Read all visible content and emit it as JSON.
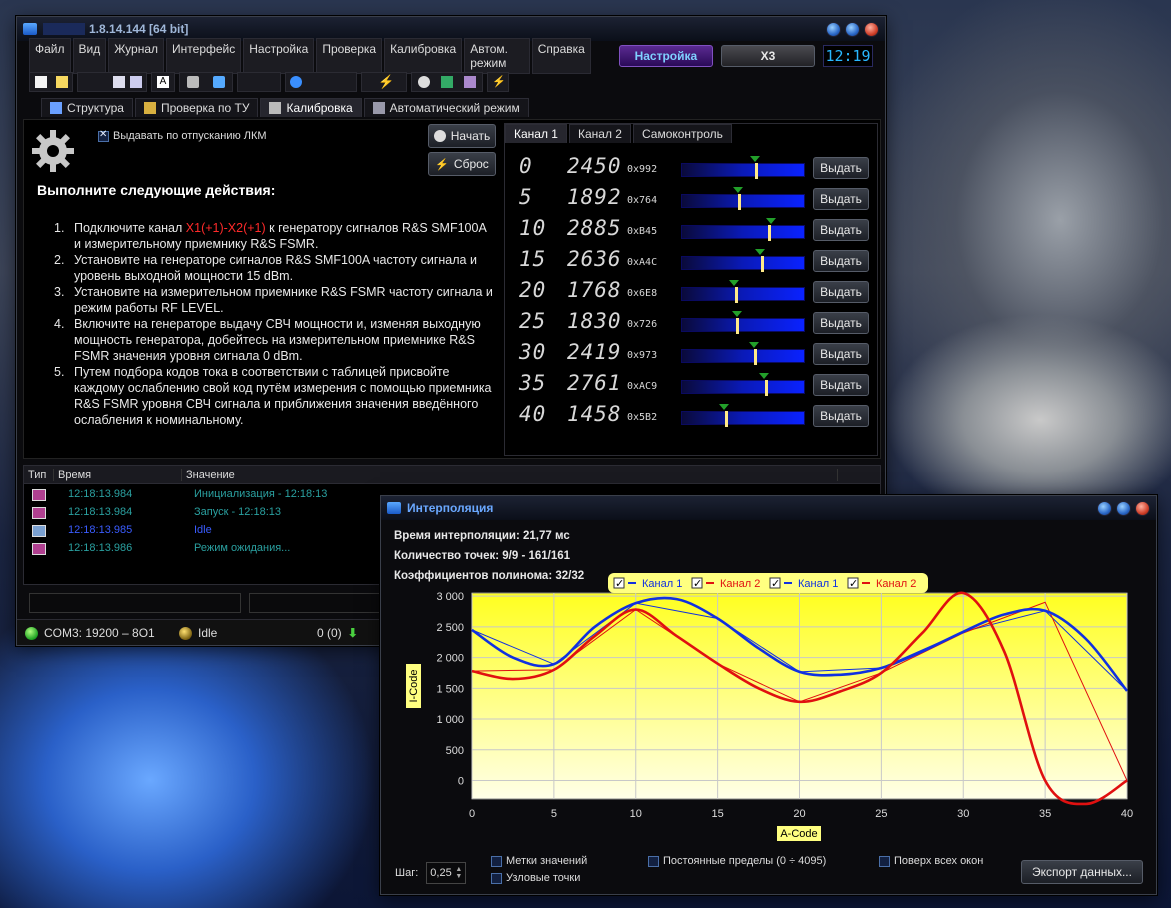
{
  "main_window": {
    "title": "1.8.14.144 [64 bit]",
    "menu": [
      "Файл",
      "Вид",
      "Журнал",
      "Интерфейс",
      "Настройка",
      "Проверка",
      "Калибровка",
      "Автом. режим",
      "Справка"
    ],
    "mode_button": "Настройка",
    "x3_button": "X3",
    "clock": "12:19",
    "tabs": [
      "Структура",
      "Проверка по ТУ",
      "Калибровка",
      "Автоматический режим"
    ],
    "active_tab": 2
  },
  "calibration": {
    "checkbox_label": "Выдавать по отпусканию ЛКМ",
    "start_button": "Начать",
    "reset_button": "Сброс",
    "heading": "Выполните следующие действия:",
    "steps": [
      {
        "n": "1.",
        "pre": "Подключите канал ",
        "red": "X1(+1)-X2(+1)",
        "post": " к генератору сигналов R&S SMF100A и измерительному приемнику R&S FSMR."
      },
      {
        "n": "2.",
        "pre": "Установите на генераторе сигналов R&S SMF100A частоту сигнала и уровень выходной мощности 15 dBm.",
        "red": "",
        "post": ""
      },
      {
        "n": "3.",
        "pre": "Установите на измерительном приемнике R&S FSMR частоту сигнала и режим работы RF LEVEL.",
        "red": "",
        "post": ""
      },
      {
        "n": "4.",
        "pre": "Включите на генераторе выдачу СВЧ мощности и, изменяя выходную мощность генератора, добейтесь на измерительном приемнике R&S FSMR значения уровня сигнала 0 dBm.",
        "red": "",
        "post": ""
      },
      {
        "n": "5.",
        "pre": "Путем подбора кодов тока в соответствии с таблицей присвойте каждому ослаблению свой код путём измерения с помощью приемника R&S FSMR уровня СВЧ сигнала и приближения значения введённого ослабления к номинальному.",
        "red": "",
        "post": ""
      }
    ],
    "channel_tabs": [
      "Канал 1",
      "Канал 2",
      "Самоконтроль"
    ],
    "issue_label": "Выдать",
    "channels": [
      {
        "att": "0",
        "code": "2450",
        "hex": "0x992",
        "level": 0.598,
        "target": 0.59
      },
      {
        "att": "5",
        "code": "1892",
        "hex": "0x764",
        "level": 0.462,
        "target": 0.45
      },
      {
        "att": "10",
        "code": "2885",
        "hex": "0xB45",
        "level": 0.704,
        "target": 0.72
      },
      {
        "att": "15",
        "code": "2636",
        "hex": "0xA4C",
        "level": 0.643,
        "target": 0.63
      },
      {
        "att": "20",
        "code": "1768",
        "hex": "0x6E8",
        "level": 0.432,
        "target": 0.42
      },
      {
        "att": "25",
        "code": "1830",
        "hex": "0x726",
        "level": 0.447,
        "target": 0.44
      },
      {
        "att": "30",
        "code": "2419",
        "hex": "0x973",
        "level": 0.591,
        "target": 0.58
      },
      {
        "att": "35",
        "code": "2761",
        "hex": "0xAC9",
        "level": 0.674,
        "target": 0.66
      },
      {
        "att": "40",
        "code": "1458",
        "hex": "0x5B2",
        "level": 0.356,
        "target": 0.34
      }
    ]
  },
  "log": {
    "headers": [
      "Тип",
      "Время",
      "Значение"
    ],
    "rows": [
      {
        "time": "12:18:13.984",
        "value": "Инициализация - 12:18:13",
        "kind": "info"
      },
      {
        "time": "12:18:13.984",
        "value": "Запуск - 12:18:13",
        "kind": "info"
      },
      {
        "time": "12:18:13.985",
        "value": "Idle",
        "kind": "gear"
      },
      {
        "time": "12:18:13.986",
        "value": "Режим ожидания...",
        "kind": "info"
      }
    ]
  },
  "statusbar": {
    "port": "COM3: 19200 – 8O1",
    "state": "Idle",
    "counter": "0 (0)"
  },
  "interp_window": {
    "title": "Интерполяция",
    "time_label": "Время интерполяции: 21,77 мс",
    "points_label": "Количество точек: 9/9 - 161/161",
    "coef_label": "Коэффициентов полинома: 32/32",
    "step_label": "Шаг:",
    "step_value": "0,25",
    "checks": [
      "Метки значений",
      "Узловые точки",
      "Постоянные пределы (0 ÷ 4095)",
      "Поверх всех окон"
    ],
    "export_button": "Экспорт данных..."
  },
  "chart_data": {
    "type": "line",
    "xlabel": "A-Code",
    "ylabel": "I-Code",
    "xlim": [
      0,
      40
    ],
    "ylim": [
      -300,
      3050
    ],
    "xticks": [
      0,
      5,
      10,
      15,
      20,
      25,
      30,
      35,
      40
    ],
    "yticks": [
      0,
      500,
      1000,
      1500,
      2000,
      2500,
      3000
    ],
    "ytick_labels": [
      "0",
      "500",
      "1 000",
      "1 500",
      "2 000",
      "2 500",
      "3 000"
    ],
    "legend": [
      "Канал 1",
      "Канал 2",
      "Канал 1",
      "Канал 2"
    ],
    "colors": {
      "channel1": "#1030e0",
      "channel2": "#e01010"
    },
    "series": [
      {
        "name": "Канал 1",
        "style": "thin",
        "color": "#1030e0",
        "x": [
          0,
          5,
          10,
          15,
          20,
          25,
          30,
          35,
          40
        ],
        "y": [
          2450,
          1892,
          2885,
          2636,
          1768,
          1830,
          2419,
          2761,
          1458
        ]
      },
      {
        "name": "Канал 2",
        "style": "thin",
        "color": "#e01010",
        "x": [
          0,
          5,
          10,
          15,
          20,
          25,
          30,
          35,
          40
        ],
        "y": [
          1780,
          1800,
          2780,
          1900,
          1280,
          1750,
          2400,
          2900,
          0
        ]
      },
      {
        "name": "Канал 1",
        "style": "thick",
        "color": "#1030e0",
        "x": [
          0,
          2.5,
          5,
          7.5,
          10,
          12.5,
          15,
          17.5,
          20,
          22.5,
          25,
          27.5,
          30,
          32.5,
          35,
          37.5,
          40
        ],
        "y": [
          2450,
          2000,
          1892,
          2500,
          2885,
          2950,
          2636,
          2150,
          1768,
          1720,
          1830,
          2100,
          2419,
          2700,
          2761,
          2300,
          1458
        ]
      },
      {
        "name": "Канал 2",
        "style": "thick",
        "color": "#e01010",
        "x": [
          0,
          2.5,
          5,
          7.5,
          10,
          12.5,
          15,
          17.5,
          20,
          22.5,
          25,
          27.5,
          30,
          32.5,
          35,
          37.5,
          40
        ],
        "y": [
          1780,
          1650,
          1800,
          2350,
          2780,
          2350,
          1900,
          1500,
          1280,
          1450,
          1750,
          2400,
          3050,
          2100,
          0,
          -380,
          0
        ]
      }
    ]
  }
}
